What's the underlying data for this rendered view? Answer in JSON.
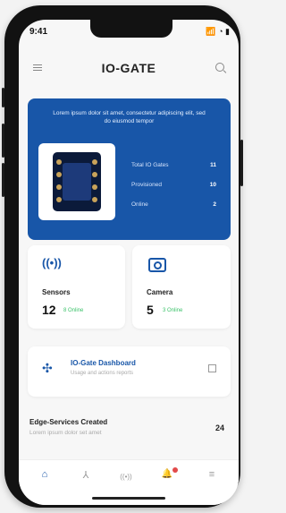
{
  "status": {
    "time": "9:41",
    "icons": "📶 ◔ ▮"
  },
  "header": {
    "title": "IO-GATE"
  },
  "hero": {
    "text": "Lorem ipsum dolor sit amet, consectetur adipiscing elit, sed do eiusmod tempor",
    "stats": [
      {
        "label": "Total IO Gates",
        "value": "11"
      },
      {
        "label": "Provisioned",
        "value": "10"
      },
      {
        "label": "Online",
        "value": "2"
      }
    ]
  },
  "cards": {
    "sensors": {
      "label": "Sensors",
      "count": "12",
      "online": "8 Online"
    },
    "camera": {
      "label": "Camera",
      "count": "5",
      "online": "3 Online"
    }
  },
  "dashboard": {
    "title": "IO-Gate Dashboard",
    "subtitle": "Usage and actions reports"
  },
  "edge": {
    "title": "Edge-Services Created",
    "subtitle": "Lorem ipsum dolor set amet",
    "count": "24"
  },
  "colors": {
    "brand": "#1856a8",
    "online": "#3bc26a",
    "badge": "#e24a4a"
  },
  "tabs": [
    {
      "icon": "home-icon",
      "glyph": "⌂",
      "active": true
    },
    {
      "icon": "network-icon",
      "glyph": "⅄"
    },
    {
      "icon": "sensor-icon",
      "glyph": "((•))"
    },
    {
      "icon": "bell-icon",
      "glyph": "🔔"
    },
    {
      "icon": "menu-icon",
      "glyph": "≡"
    }
  ]
}
